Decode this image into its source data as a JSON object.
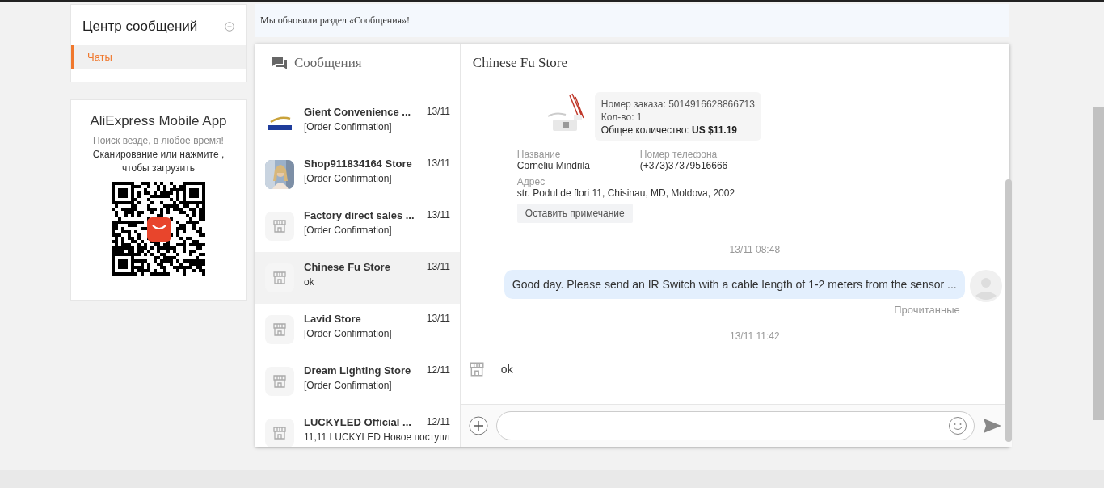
{
  "sidebar": {
    "title": "Центр сообщений",
    "items": [
      {
        "label": "Чаты",
        "selected": true
      }
    ]
  },
  "app_promo": {
    "title": "AliExpress Mobile App",
    "subtitle": "Поиск везде, в любое время!",
    "text": "Сканирование или нажмите , чтобы загрузить"
  },
  "banner": "Мы обновили раздел «Сообщения»!",
  "conversations_header": "Сообщения",
  "conversations": [
    {
      "name": "Gient Convenience ...",
      "date": "13/11",
      "preview": "[Order Confirmation]",
      "kind": "logo",
      "selected": false
    },
    {
      "name": "Shop911834164 Store",
      "date": "13/11",
      "preview": "[Order Confirmation]",
      "selected": false
    },
    {
      "name": "Factory direct sales ...",
      "date": "13/11",
      "preview": "[Order Confirmation]",
      "kind": "store",
      "selected": false
    },
    {
      "name": "Chinese Fu Store",
      "date": "13/11",
      "preview": "ok",
      "kind": "store",
      "selected": true
    },
    {
      "name": "Lavid Store",
      "date": "13/11",
      "preview": "[Order Confirmation]",
      "kind": "store",
      "selected": false
    },
    {
      "name": "Dream Lighting Store",
      "date": "12/11",
      "preview": "[Order Confirmation]",
      "kind": "store",
      "selected": false
    },
    {
      "name": "LUCKYLED Official ...",
      "date": "12/11",
      "preview": "11,11 LUCKYLED Новое поступл",
      "kind": "store",
      "selected": false
    }
  ],
  "chat": {
    "title": "Chinese Fu Store",
    "order": {
      "number": "Номер заказа: 5014916628866713",
      "quantity": "Кол-во: 1",
      "total_label": "Общее количество:",
      "total": "US $11.19"
    },
    "fields": [
      {
        "label": "Название",
        "value": "Corneliu Mindrila"
      },
      {
        "label": "Номер телефона",
        "value": "(+373)37379516666"
      },
      {
        "label": "Адрес",
        "value": "str. Podul de flori 11, Chisinau, MD, Moldova, 2002"
      }
    ],
    "note_button": "Оставить примечание",
    "messages": [
      {
        "kind": "time",
        "text": "13/11 08:48"
      },
      {
        "kind": "outgoing",
        "text": "Good day. Please send an IR Switch with a cable length of 1-2 meters from the sensor ...",
        "status": "Прочитанные"
      },
      {
        "kind": "time",
        "text": "13/11 11:42"
      },
      {
        "kind": "incoming",
        "text": "ok"
      }
    ]
  }
}
